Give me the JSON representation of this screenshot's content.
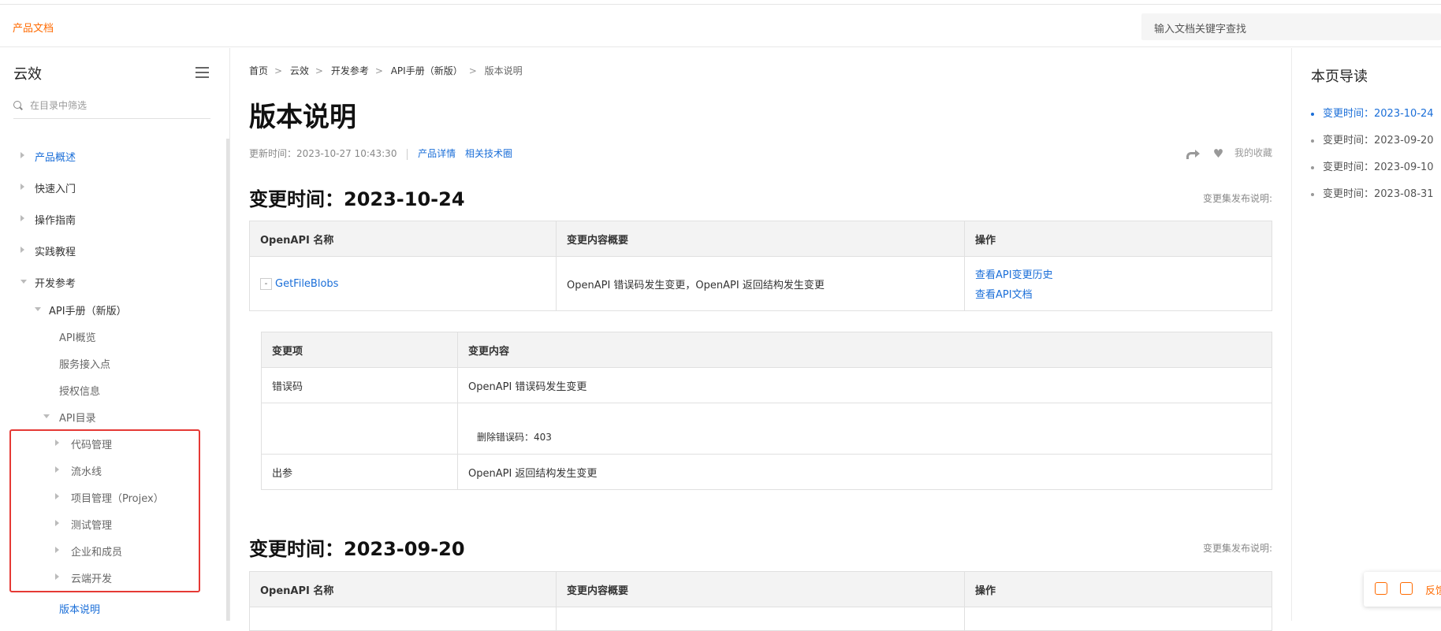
{
  "header": {
    "brand": "产品文档",
    "search_placeholder": "输入文档关键字查找"
  },
  "sidebar": {
    "title": "云效",
    "filter_placeholder": "在目录中筛选",
    "items": [
      {
        "label": "产品概述"
      },
      {
        "label": "快速入门"
      },
      {
        "label": "操作指南"
      },
      {
        "label": "实践教程"
      },
      {
        "label": "开发参考"
      },
      {
        "label": "API手册（新版）"
      },
      {
        "label": "API概览"
      },
      {
        "label": "服务接入点"
      },
      {
        "label": "授权信息"
      },
      {
        "label": "API目录"
      },
      {
        "label": "代码管理"
      },
      {
        "label": "流水线"
      },
      {
        "label": "项目管理（Projex）"
      },
      {
        "label": "测试管理"
      },
      {
        "label": "企业和成员"
      },
      {
        "label": "云端开发"
      },
      {
        "label": "版本说明"
      }
    ]
  },
  "breadcrumb": [
    "首页",
    "云效",
    "开发参考",
    "API手册（新版）",
    "版本说明"
  ],
  "page": {
    "title": "版本说明",
    "updated": "更新时间：2023-10-27 10:43:30",
    "link_product": "产品详情",
    "link_forum": "相关技术圈",
    "favorite": "我的收藏"
  },
  "sections": [
    {
      "heading": "变更时间：2023-10-24",
      "note": "变更集发布说明:",
      "table_headers": [
        "OpenAPI 名称",
        "变更内容概要",
        "操作"
      ],
      "row": {
        "expander": "-",
        "name": "GetFileBlobs",
        "summary": "OpenAPI 错误码发生变更，OpenAPI 返回结构发生变更",
        "action1": "查看API变更历史",
        "action2": "查看API文档"
      },
      "detail_headers": [
        "变更项",
        "变更内容"
      ],
      "detail_rows": [
        {
          "item": "错误码",
          "content": "OpenAPI 错误码发生变更"
        },
        {
          "item": "",
          "content": "删除错误码：403"
        },
        {
          "item": "出参",
          "content": "OpenAPI 返回结构发生变更"
        }
      ]
    },
    {
      "heading": "变更时间：2023-09-20",
      "note": "变更集发布说明:",
      "table_headers": [
        "OpenAPI 名称",
        "变更内容概要",
        "操作"
      ]
    }
  ],
  "toc": {
    "title": "本页导读",
    "items": [
      "变更时间：2023-10-24",
      "变更时间：2023-09-20",
      "变更时间：2023-09-10",
      "变更时间：2023-08-31"
    ]
  },
  "feedback": {
    "label": "反馈"
  }
}
